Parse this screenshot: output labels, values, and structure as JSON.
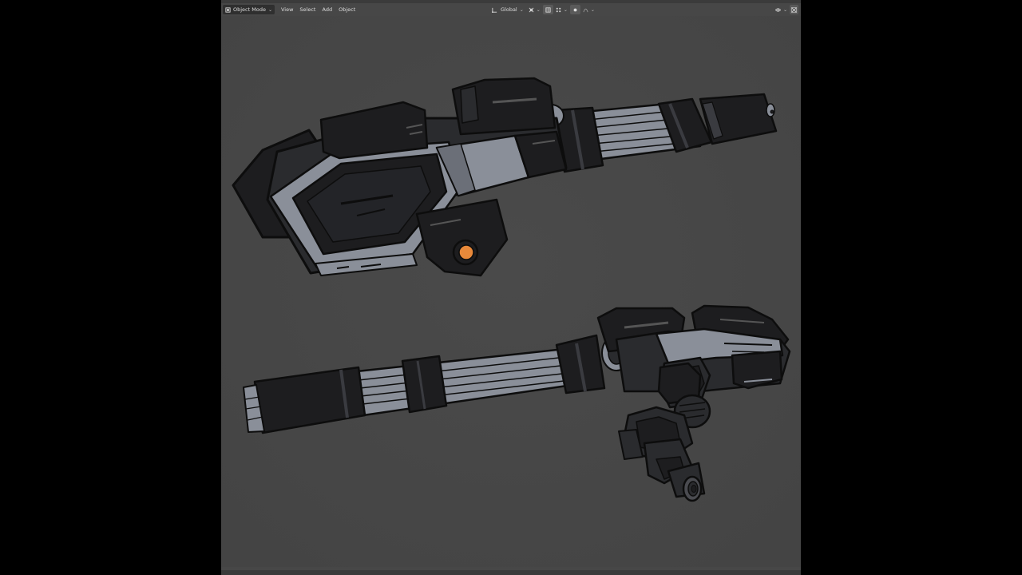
{
  "header": {
    "mode_label": "Object Mode",
    "menus": [
      "View",
      "Select",
      "Add",
      "Object"
    ],
    "orientation_label": "Global"
  },
  "icons": [
    "object-mode-icon",
    "orientation-icon",
    "pivot-icon",
    "snap-icon",
    "proportional-edit-icon",
    "visibility-icon",
    "gizmo-icon"
  ],
  "colors": {
    "viewport_bg": "#474747",
    "outline": "#0d0d0d",
    "dark_panel": "#1d1d1f",
    "mid_panel": "#2a2b2e",
    "light_trim": "#8a8f99",
    "accent_orange": "#e8893a"
  }
}
